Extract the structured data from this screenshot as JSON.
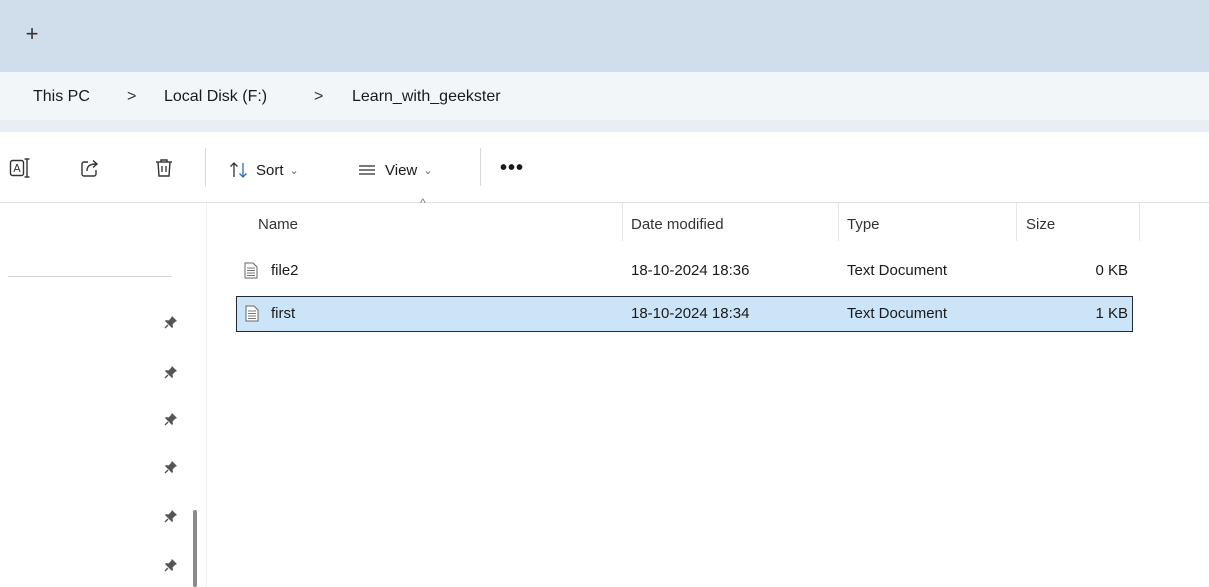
{
  "tabbar": {
    "new_tab_symbol": "+"
  },
  "breadcrumb": {
    "items": [
      "This PC",
      "Local Disk (F:)",
      "Learn_with_geekster"
    ],
    "separator": ">"
  },
  "toolbar": {
    "icons": [
      "rename-icon",
      "share-icon",
      "delete-icon"
    ],
    "sort_label": "Sort",
    "view_label": "View",
    "more_label": "•••",
    "chevron": "⌄"
  },
  "columns": {
    "name": "Name",
    "date": "Date modified",
    "type": "Type",
    "size": "Size",
    "sort_indicator": "^"
  },
  "files": [
    {
      "name": "file2",
      "date": "18-10-2024 18:36",
      "type": "Text Document",
      "size": "0 KB",
      "selected": false
    },
    {
      "name": "first",
      "date": "18-10-2024 18:34",
      "type": "Text Document",
      "size": "1 KB",
      "selected": true
    }
  ],
  "nav_pins": 6,
  "colors": {
    "tabbar_bg": "#cfdeea",
    "selection_bg": "#cce4f7",
    "selection_border": "#1e2a36"
  }
}
